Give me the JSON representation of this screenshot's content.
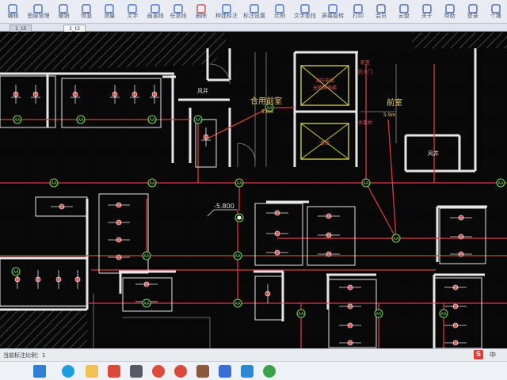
{
  "toolbar": {
    "items": [
      {
        "label": "编辑",
        "icon": "edit-icon"
      },
      {
        "label": "图层管理",
        "icon": "layers-icon"
      },
      {
        "label": "撤销",
        "icon": "undo-icon"
      },
      {
        "label": "恢复",
        "icon": "redo-icon"
      },
      {
        "label": "测量",
        "icon": "measure-icon"
      },
      {
        "label": "文字",
        "icon": "text-icon"
      },
      {
        "label": "画直线",
        "icon": "line-icon"
      },
      {
        "label": "任意线",
        "icon": "freehand-icon"
      },
      {
        "label": "删除",
        "icon": "delete-icon"
      },
      {
        "label": "种建标注",
        "icon": "annotate-icon"
      },
      {
        "label": "标注设置",
        "icon": "annotation-settings-icon"
      },
      {
        "label": "比例",
        "icon": "scale-icon"
      },
      {
        "label": "文字查找",
        "icon": "text-search-icon"
      },
      {
        "label": "屏幕旋转",
        "icon": "rotate-icon"
      },
      {
        "label": "打印",
        "icon": "print-icon"
      },
      {
        "label": "会员",
        "icon": "vip-icon"
      },
      {
        "label": "云盘",
        "icon": "cloud-icon"
      },
      {
        "label": "关于",
        "icon": "about-icon"
      },
      {
        "label": "帮助",
        "icon": "help-icon"
      },
      {
        "label": "登录",
        "icon": "login-icon"
      },
      {
        "label": "个铺",
        "icon": "user-icon"
      }
    ]
  },
  "tabs": [
    {
      "label": "1_t3",
      "active": false
    },
    {
      "label": "1_t3",
      "active": true
    }
  ],
  "drawing": {
    "room_labels": {
      "wind_shaft_1": "风井",
      "shared_front_room": "合用前室",
      "front_room": "前室",
      "wind_shaft_2": "风井",
      "elevator_1": "消防电梯\n无障碍电梯",
      "elevator_2": "货梯",
      "area_1": "5.0m",
      "area_2": "5.9m"
    },
    "elevation": "-5.800",
    "node_label": "AA",
    "small_labels": [
      "前室",
      "防火门",
      "水管井"
    ]
  },
  "status": {
    "text": "当前标注比例：1"
  },
  "tray": {
    "ime_badge": "S",
    "ime_lang": "中"
  }
}
